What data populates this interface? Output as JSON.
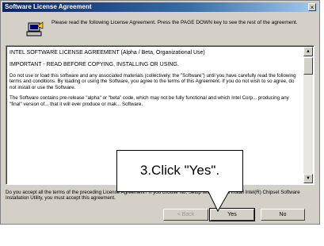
{
  "window": {
    "title": "Software License Agreement",
    "close_label": "×"
  },
  "header": {
    "icon": "setup-computer-icon",
    "instruction": "Please read the following License Agreement.  Press the PAGE DOWN key to see the rest of the agreement."
  },
  "license": {
    "heading": "INTEL SOFTWARE LICENSE AGREEMENT (Alpha / Beta, Organizational Use)",
    "important": "IMPORTANT - READ BEFORE COPYING, INSTALLING OR USING.",
    "para1": "Do not use or load this software and any associated materials (collectively, the \"Software\") until you have carefully read the following terms and conditions.  By loading or using the Software, you agree to the terms of this Agreement.  If you do not wish to so agree, do not install or use the Software.",
    "para2": "The Software contains pre-release \"alpha\" or \"beta\" code, which may not be fully functional and which Intel Corp... producing any \"final\" version of... that it will ever produce or mak... Software."
  },
  "scrollbar": {
    "up_icon": "▲",
    "down_icon": "▼"
  },
  "question": "Do you accept all the terms of the preceding License Agreement?  If you choose No, Setup will close.  To install Intel(R) Chipset Software Installation Utility, you must accept this agreement.",
  "buttons": {
    "back": "< Back",
    "yes": "Yes",
    "no": "No"
  },
  "callout": {
    "text": "3.Click \"Yes\"."
  }
}
